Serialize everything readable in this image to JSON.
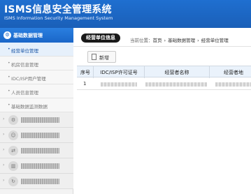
{
  "header": {
    "title": "ISMS信息安全管理系统",
    "subtitle": "ISMS Information Security Management System"
  },
  "sidebar": {
    "active_group": {
      "label": "基础数据管理",
      "icon": "gear-icon"
    },
    "sub_items": [
      {
        "label": "经营单位管理",
        "active": true
      },
      {
        "label": "机房信息管理",
        "active": false
      },
      {
        "label": "IDC/ISP用户管理",
        "active": false
      },
      {
        "label": "人员信息管理",
        "active": false
      },
      {
        "label": "基础数据监测数据",
        "active": false
      }
    ],
    "collapsed_groups": [
      {
        "icon": "gear-icon"
      },
      {
        "icon": "user-icon"
      },
      {
        "icon": "shuffle-icon"
      },
      {
        "icon": "chart-icon"
      },
      {
        "icon": "refresh-icon"
      }
    ]
  },
  "breadcrumb": {
    "badge": "经营单位信息",
    "prefix": "当前位置：",
    "items": [
      "首页",
      "基础数据管理",
      "经营单位管理"
    ]
  },
  "toolbar": {
    "add_label": "新增"
  },
  "table": {
    "columns": [
      "序号",
      "IDC/ISP许可证号",
      "经营者名称",
      "经营者地"
    ],
    "rows": [
      {
        "index": "1"
      }
    ]
  }
}
